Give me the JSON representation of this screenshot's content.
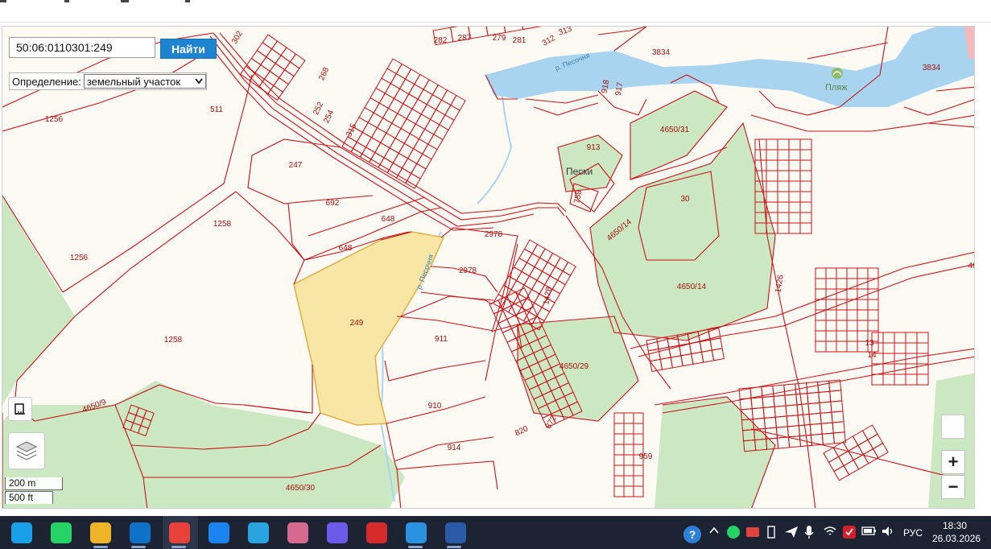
{
  "search": {
    "value": "50:06:0110301:249",
    "button_label": "Найти"
  },
  "definition": {
    "label": "Определение:",
    "selected": "земельный участок"
  },
  "map": {
    "parcel_labels": [
      "1256",
      "511",
      "247",
      "692",
      "648",
      "648",
      "1258",
      "1256",
      "1258",
      "249",
      "2978",
      "2978",
      "911",
      "910",
      "914",
      "4650/9",
      "4650/30",
      "913",
      "758",
      "30",
      "4650/31",
      "4650/14",
      "4650/14",
      "4650/29",
      "1426",
      "1428",
      "820",
      "872",
      "959",
      "13",
      "14",
      "3834",
      "3834",
      "918",
      "917",
      "302",
      "282",
      "287",
      "279",
      "281",
      "312",
      "313",
      "268",
      "252",
      "254",
      "315",
      "46"
    ],
    "place_labels": {
      "village": "Пески",
      "beach": "Пляж",
      "river_1": "р. Песочня",
      "river_2": "р. Песочня"
    },
    "colors": {
      "parcel_line": "#c8121a",
      "highlight_fill": "#f7e6a6",
      "highlight_stroke": "#e2b24a",
      "water": "#a8d4f0",
      "forest": "#cce8c2",
      "background": "#fdfaf3"
    }
  },
  "scale": {
    "metric": "200 m",
    "imperial": "500 ft"
  },
  "zoom": {
    "in": "+",
    "out": "−"
  },
  "taskbar": {
    "apps": [
      "edge-icon",
      "whatsapp-icon",
      "file-explorer-icon",
      "outlook-icon",
      "yandex-browser-icon",
      "dropbox-icon",
      "telegram-icon",
      "umbrella-app-icon",
      "messenger-icon",
      "pdf-reader-icon",
      "photos-icon",
      "word-icon"
    ],
    "tray_language": "РУС",
    "time": "18:30",
    "date": "26.03.2026"
  }
}
